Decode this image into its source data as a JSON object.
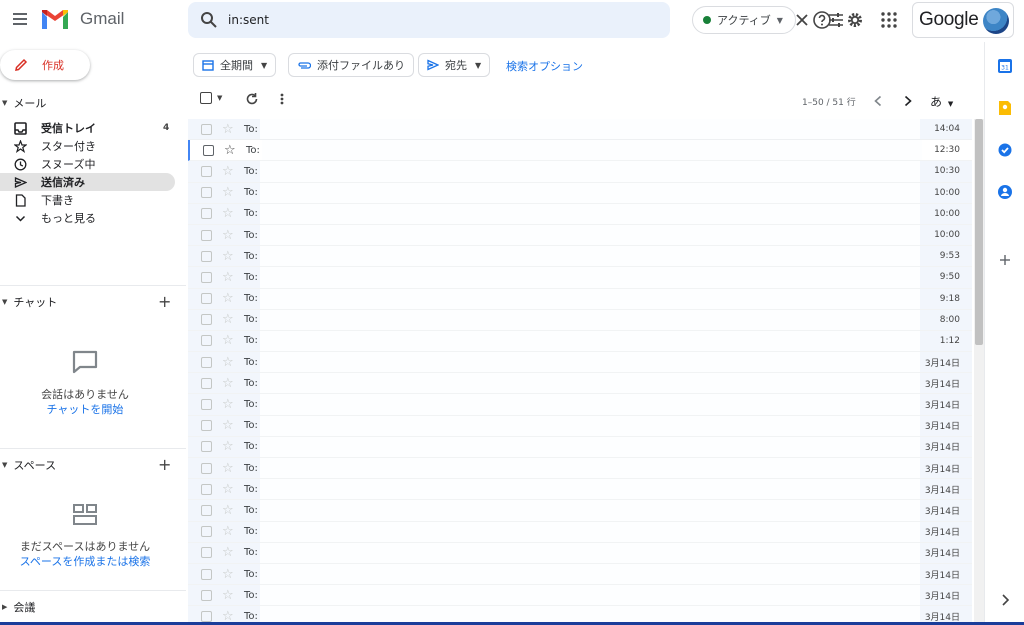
{
  "app": {
    "name": "Gmail"
  },
  "search": {
    "value": "in:sent"
  },
  "status": {
    "label": "アクティブ",
    "color": "#188038"
  },
  "account": {
    "brand": "Google"
  },
  "sidebar": {
    "compose_label": "作成",
    "mail_section": "メール",
    "items": [
      {
        "label": "受信トレイ",
        "count": "4",
        "icon": "inbox-icon",
        "bold": true
      },
      {
        "label": "スター付き",
        "icon": "star-icon"
      },
      {
        "label": "スヌーズ中",
        "icon": "clock-icon"
      },
      {
        "label": "送信済み",
        "icon": "send-icon",
        "active": true
      },
      {
        "label": "下書き",
        "icon": "draft-icon"
      },
      {
        "label": "もっと見る",
        "icon": "chevron-down-icon"
      }
    ],
    "chat": {
      "title": "チャット",
      "empty_text": "会話はありません",
      "link": "チャットを開始"
    },
    "spaces": {
      "title": "スペース",
      "empty_text": "まだスペースはありません",
      "link": "スペースを作成または検索"
    },
    "meet": {
      "title": "会議"
    }
  },
  "filters": {
    "date": "全期間",
    "attachment": "添付ファイルあり",
    "to": "宛先",
    "advanced": "検索オプション"
  },
  "toolbar": {
    "pagination": "1–50 / 51 行",
    "input_tool": "あ"
  },
  "mail_list": {
    "recipient_prefix": "To:",
    "rows": [
      {
        "time": "14:04"
      },
      {
        "time": "12:30",
        "focused": true
      },
      {
        "time": "10:30"
      },
      {
        "time": "10:00"
      },
      {
        "time": "10:00"
      },
      {
        "time": "10:00"
      },
      {
        "time": "9:53"
      },
      {
        "time": "9:50"
      },
      {
        "time": "9:18"
      },
      {
        "time": "8:00"
      },
      {
        "time": "1:12"
      },
      {
        "time": "3月14日"
      },
      {
        "time": "3月14日"
      },
      {
        "time": "3月14日"
      },
      {
        "time": "3月14日"
      },
      {
        "time": "3月14日"
      },
      {
        "time": "3月14日"
      },
      {
        "time": "3月14日"
      },
      {
        "time": "3月14日"
      },
      {
        "time": "3月14日"
      },
      {
        "time": "3月14日"
      },
      {
        "time": "3月14日"
      },
      {
        "time": "3月14日"
      },
      {
        "time": "3月14日"
      }
    ]
  },
  "colors": {
    "accent_red": "#d93025",
    "link_blue": "#1a73e8",
    "search_bg": "#eaf1fb"
  }
}
